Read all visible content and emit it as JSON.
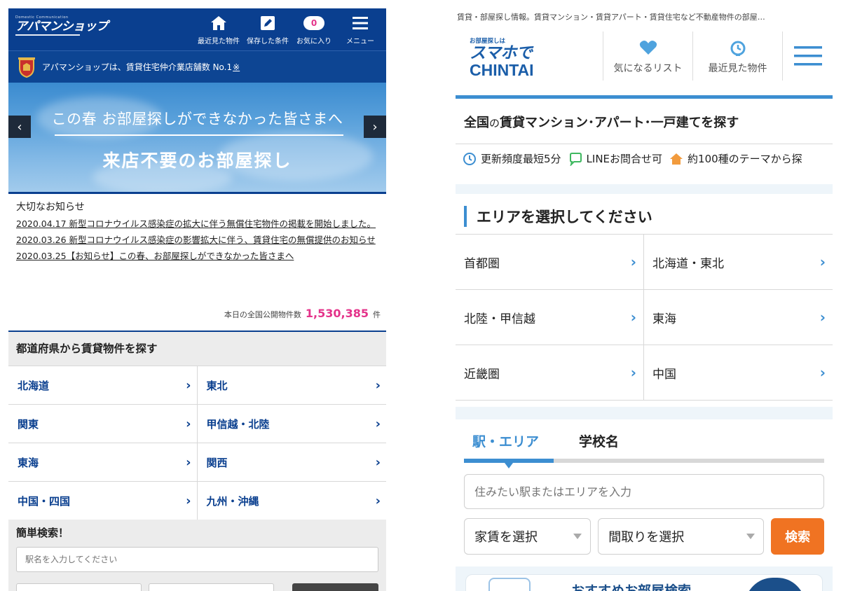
{
  "apamanshop": {
    "logo_small": "Domestic Communication",
    "logo": "アパマンショップ",
    "nav": [
      {
        "icon": "home-icon",
        "label": "最近見た物件"
      },
      {
        "icon": "pencil-icon",
        "label": "保存した条件"
      },
      {
        "icon": "favorite-count-badge",
        "label": "お気に入り",
        "count": "0"
      },
      {
        "icon": "hamburger-menu-icon",
        "label": "メニュー"
      }
    ],
    "tagline": "アパマンショップは、賃貸住宅仲介業店舗数 No.1",
    "tagline_note": "※",
    "banner": {
      "line1": "この春 お部屋探しができなかった皆さまへ",
      "line2": "来店不要のお部屋探し",
      "prev": "‹",
      "next": "›"
    },
    "news": {
      "title": "大切なお知らせ",
      "items": [
        "2020.04.17 新型コロナウイルス感染症の拡大に伴う無償住宅物件の掲載を開始しました。",
        "2020.03.26 新型コロナウイルス感染症の影響拡大に伴う、賃貸住宅の無償提供のお知らせ",
        "2020.03.25【お知らせ】この春、お部屋探しができなかった皆さまへ"
      ]
    },
    "count": {
      "label": "本日の全国公開物件数",
      "value": "1,530,385",
      "unit": "件"
    },
    "prefecture_search": {
      "title": "都道府県から賃貸物件を探す",
      "regions": [
        "北海道",
        "東北",
        "関東",
        "甲信越・北陸",
        "東海",
        "関西",
        "中国・四国",
        "九州・沖縄"
      ]
    },
    "quick_search": {
      "title": "簡単検索！",
      "placeholder": "駅名を入力してください"
    },
    "colors": {
      "brand": "#0a3f8f",
      "accent": "#e4338a"
    }
  },
  "chintai": {
    "top_text": "賃貸・部屋探し情報。賃貸マンション・賃貸アパート・賃貸住宅など不動産物件の部屋…",
    "logo_small": "お部屋探しは",
    "logo_main": "スマホで",
    "logo_brand": "CHINTAI",
    "nav": [
      {
        "icon": "heart-icon",
        "label": "気になるリスト"
      },
      {
        "icon": "clock-history-icon",
        "label": "最近見た物件"
      },
      {
        "icon": "hamburger-menu-icon",
        "label": ""
      }
    ],
    "hero": {
      "title_pre": "全国",
      "title_mid": "の",
      "title_post": "賃貸マンション･アパート･一戸建てを探す"
    },
    "features": [
      {
        "icon": "clock-icon",
        "label": "更新頻度最短5分"
      },
      {
        "icon": "chat-bubble-icon",
        "label": "LINEお問合せ可"
      },
      {
        "icon": "house-icon",
        "label": "約100種のテーマから探"
      }
    ],
    "area": {
      "title": "エリアを選択してください",
      "regions": [
        "首都圏",
        "北海道・東北",
        "北陸・甲信越",
        "東海",
        "近畿圏",
        "中国"
      ]
    },
    "search": {
      "tabs": [
        "駅・エリア",
        "学校名"
      ],
      "placeholder": "住みたい駅またはエリアを入力",
      "rent_select": "家賃を選択",
      "layout_select": "間取りを選択",
      "button": "検索"
    },
    "recommend_title": "おすすめお部屋検索",
    "colors": {
      "brand": "#1b5ea9",
      "accent": "#3c8ed1",
      "button": "#f07322"
    }
  }
}
